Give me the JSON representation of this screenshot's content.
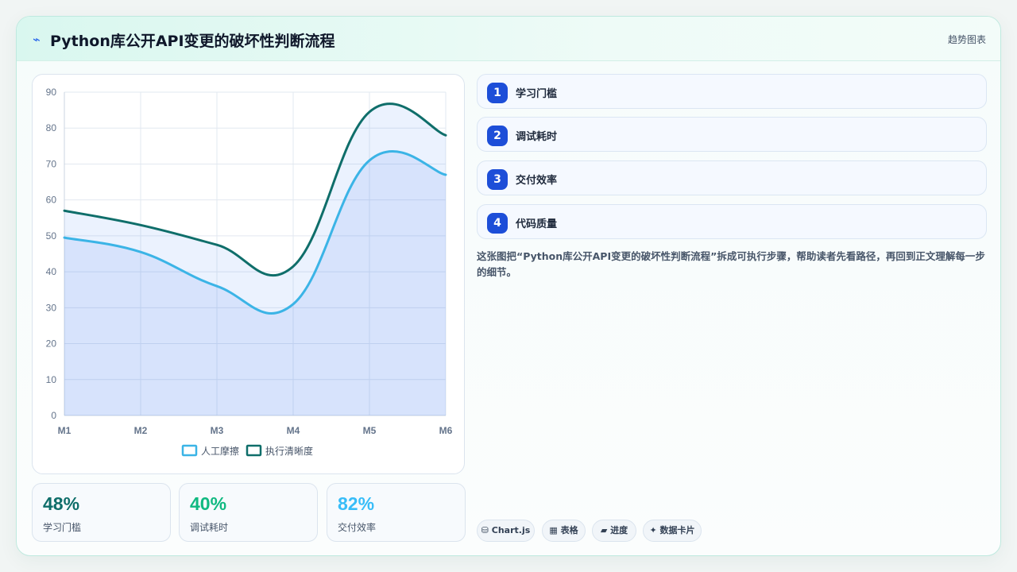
{
  "header": {
    "icon": "pulse-icon",
    "title": "Python库公开API变更的破坏性判断流程",
    "tag": "趋势图表"
  },
  "chart_data": {
    "type": "area",
    "categories": [
      "M1",
      "M2",
      "M3",
      "M4",
      "M5",
      "M6"
    ],
    "ylim": [
      0,
      90
    ],
    "yticks": [
      0,
      10,
      20,
      30,
      40,
      50,
      60,
      70,
      80,
      90
    ],
    "grid": true,
    "legend_position": "bottom",
    "series": [
      {
        "name": "人工摩擦",
        "values": [
          49.5,
          45.5,
          36,
          31,
          71,
          67
        ],
        "color": "#3bb4e6",
        "fill": "rgba(37, 99, 235, 0.10)"
      },
      {
        "name": "执行清晰度",
        "values": [
          57,
          53,
          47.5,
          41.5,
          84.5,
          78
        ],
        "color": "#0f6e6a",
        "fill": "rgba(59, 130, 246, 0.10)"
      }
    ]
  },
  "stats": [
    {
      "value": "48%",
      "label": "学习门槛",
      "color": "#0f6e6a"
    },
    {
      "value": "40%",
      "label": "调试耗时",
      "color": "#10b981"
    },
    {
      "value": "82%",
      "label": "交付效率",
      "color": "#38bdf8"
    }
  ],
  "steps": [
    {
      "num": "1",
      "label": "学习门槛"
    },
    {
      "num": "2",
      "label": "调试耗时"
    },
    {
      "num": "3",
      "label": "交付效率"
    },
    {
      "num": "4",
      "label": "代码质量"
    }
  ],
  "description": "这张图把“Python库公开API变更的破坏性判断流程”拆成可执行步骤，帮助读者先看路径，再回到正文理解每一步的细节。",
  "tech_pills": [
    {
      "icon": "database-icon",
      "glyph": "⛁",
      "label": "Chart.js"
    },
    {
      "icon": "table-icon",
      "glyph": "▦",
      "label": "表格"
    },
    {
      "icon": "progress-icon",
      "glyph": "▰",
      "label": "进度"
    },
    {
      "icon": "sparkle-icon",
      "glyph": "✦",
      "label": "数据卡片"
    }
  ]
}
